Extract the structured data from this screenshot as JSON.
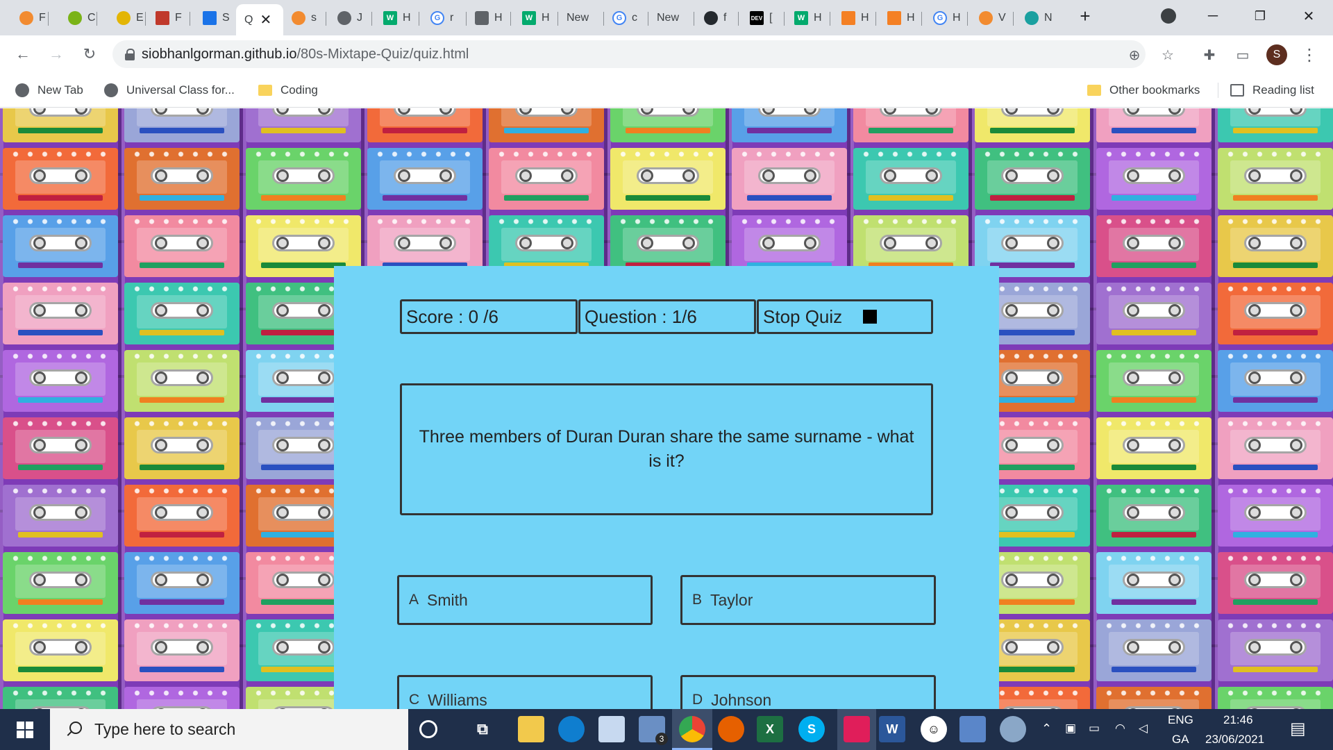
{
  "browser": {
    "tabs": [
      {
        "label": "F",
        "color": "#f28b30"
      },
      {
        "label": "C",
        "color": "#7ab317"
      },
      {
        "label": "E",
        "color": "#e3b505"
      },
      {
        "label": "F",
        "color": "#c0392b"
      },
      {
        "label": "S",
        "color": "#1a73e8"
      },
      {
        "label": "Q",
        "color": "#ffffff",
        "active": true
      },
      {
        "label": "s",
        "color": "#f28b30"
      },
      {
        "label": "J",
        "color": "#5f6368"
      },
      {
        "label": "H",
        "color": "#04aa6d"
      },
      {
        "label": "r",
        "color": "#4285f4"
      },
      {
        "label": "H",
        "color": "#5f6368"
      },
      {
        "label": "H",
        "color": "#04aa6d"
      },
      {
        "label": "New",
        "color": ""
      },
      {
        "label": "c",
        "color": "#4285f4"
      },
      {
        "label": "New",
        "color": ""
      },
      {
        "label": "f",
        "color": "#24292e"
      },
      {
        "label": "[",
        "color": "#000000"
      },
      {
        "label": "H",
        "color": "#04aa6d"
      },
      {
        "label": "H",
        "color": "#f48024"
      },
      {
        "label": "H",
        "color": "#f48024"
      },
      {
        "label": "H",
        "color": "#4285f4"
      },
      {
        "label": "V",
        "color": "#f28b30"
      },
      {
        "label": "N",
        "color": "#1aa0a0"
      }
    ],
    "url_host": "siobhanlgorman.github.io",
    "url_path": "/80s-Mixtape-Quiz/quiz.html",
    "profile_initial": "S",
    "bookmarks": {
      "new_tab": "New Tab",
      "universal": "Universal Class for...",
      "coding": "Coding",
      "other": "Other bookmarks",
      "reading": "Reading list"
    }
  },
  "quiz": {
    "score_label": "Score : 0 /6",
    "question_counter": "Question : 1/6",
    "stop_label": "Stop Quiz",
    "question": "Three members of Duran Duran share the same surname - what is it?",
    "answers": [
      {
        "letter": "A",
        "text": "Smith"
      },
      {
        "letter": "B",
        "text": "Taylor"
      },
      {
        "letter": "C",
        "text": "Williams"
      },
      {
        "letter": "D",
        "text": "Johnson"
      }
    ]
  },
  "taskbar": {
    "search_placeholder": "Type here to search",
    "language": "ENG",
    "layout": "GA",
    "time": "21:46",
    "date": "23/06/2021",
    "mail_badge": "3"
  },
  "colors": {
    "quiz_card": "#72d4f7",
    "taskbar": "#1f2f4a"
  }
}
